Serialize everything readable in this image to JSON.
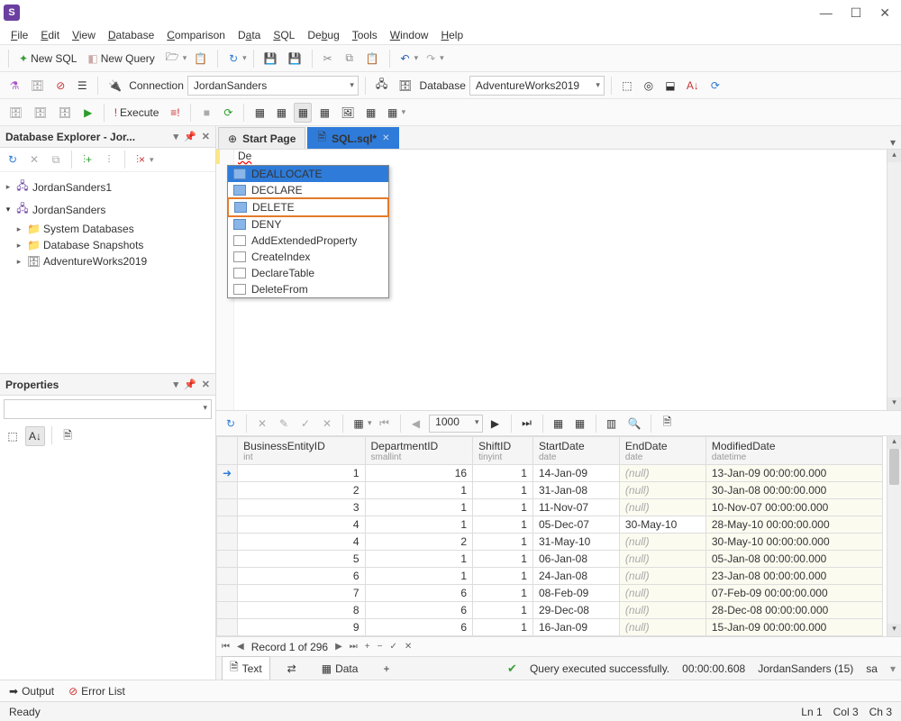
{
  "window": {
    "minimize": "—",
    "maximize": "☐",
    "close": "✕"
  },
  "menu": {
    "file": "File",
    "edit": "Edit",
    "view": "View",
    "database": "Database",
    "comparison": "Comparison",
    "data": "Data",
    "sql": "SQL",
    "debug": "Debug",
    "tools": "Tools",
    "window": "Window",
    "help": "Help"
  },
  "toolbar1": {
    "newsql": "New SQL",
    "newquery": "New Query"
  },
  "toolbar2": {
    "connection_lbl": "Connection",
    "connection_val": "JordanSanders",
    "database_lbl": "Database",
    "database_val": "AdventureWorks2019"
  },
  "toolbar3": {
    "execute": "Execute"
  },
  "explorer": {
    "title": "Database Explorer - Jor...",
    "n1": "JordanSanders1",
    "n2": "JordanSanders",
    "n3": "System Databases",
    "n4": "Database Snapshots",
    "n5": "AdventureWorks2019"
  },
  "properties": {
    "title": "Properties"
  },
  "tabs": {
    "start": "Start Page",
    "sql": "SQL.sql*"
  },
  "editor": {
    "typed": "De"
  },
  "autocomplete": {
    "i0": "DEALLOCATE",
    "i1": "DECLARE",
    "i2": "DELETE",
    "i3": "DENY",
    "i4": "AddExtendedProperty",
    "i5": "CreateIndex",
    "i6": "DeclareTable",
    "i7": "DeleteFrom"
  },
  "gridtb": {
    "pager": "1000"
  },
  "columns": {
    "c0": {
      "n": "BusinessEntityID",
      "t": "int"
    },
    "c1": {
      "n": "DepartmentID",
      "t": "smallint"
    },
    "c2": {
      "n": "ShiftID",
      "t": "tinyint"
    },
    "c3": {
      "n": "StartDate",
      "t": "date"
    },
    "c4": {
      "n": "EndDate",
      "t": "date"
    },
    "c5": {
      "n": "ModifiedDate",
      "t": "datetime"
    }
  },
  "rows": [
    {
      "be": "1",
      "dep": "16",
      "sh": "1",
      "sd": "14-Jan-09",
      "ed": "(null)",
      "md": "13-Jan-09 00:00:00.000"
    },
    {
      "be": "2",
      "dep": "1",
      "sh": "1",
      "sd": "31-Jan-08",
      "ed": "(null)",
      "md": "30-Jan-08 00:00:00.000"
    },
    {
      "be": "3",
      "dep": "1",
      "sh": "1",
      "sd": "11-Nov-07",
      "ed": "(null)",
      "md": "10-Nov-07 00:00:00.000"
    },
    {
      "be": "4",
      "dep": "1",
      "sh": "1",
      "sd": "05-Dec-07",
      "ed": "30-May-10",
      "md": "28-May-10 00:00:00.000"
    },
    {
      "be": "4",
      "dep": "2",
      "sh": "1",
      "sd": "31-May-10",
      "ed": "(null)",
      "md": "30-May-10 00:00:00.000"
    },
    {
      "be": "5",
      "dep": "1",
      "sh": "1",
      "sd": "06-Jan-08",
      "ed": "(null)",
      "md": "05-Jan-08 00:00:00.000"
    },
    {
      "be": "6",
      "dep": "1",
      "sh": "1",
      "sd": "24-Jan-08",
      "ed": "(null)",
      "md": "23-Jan-08 00:00:00.000"
    },
    {
      "be": "7",
      "dep": "6",
      "sh": "1",
      "sd": "08-Feb-09",
      "ed": "(null)",
      "md": "07-Feb-09 00:00:00.000"
    },
    {
      "be": "8",
      "dep": "6",
      "sh": "1",
      "sd": "29-Dec-08",
      "ed": "(null)",
      "md": "28-Dec-08 00:00:00.000"
    },
    {
      "be": "9",
      "dep": "6",
      "sh": "1",
      "sd": "16-Jan-09",
      "ed": "(null)",
      "md": "15-Jan-09 00:00:00.000"
    }
  ],
  "nav": {
    "record": "Record 1 of 296"
  },
  "foot": {
    "text": "Text",
    "data": "Data",
    "status": "Query executed successfully.",
    "time": "00:00:00.608",
    "conn": "JordanSanders (15)",
    "user": "sa"
  },
  "bottom": {
    "output": "Output",
    "errors": "Error List"
  },
  "status": {
    "ready": "Ready",
    "ln": "Ln 1",
    "col": "Col 3",
    "ch": "Ch 3"
  }
}
